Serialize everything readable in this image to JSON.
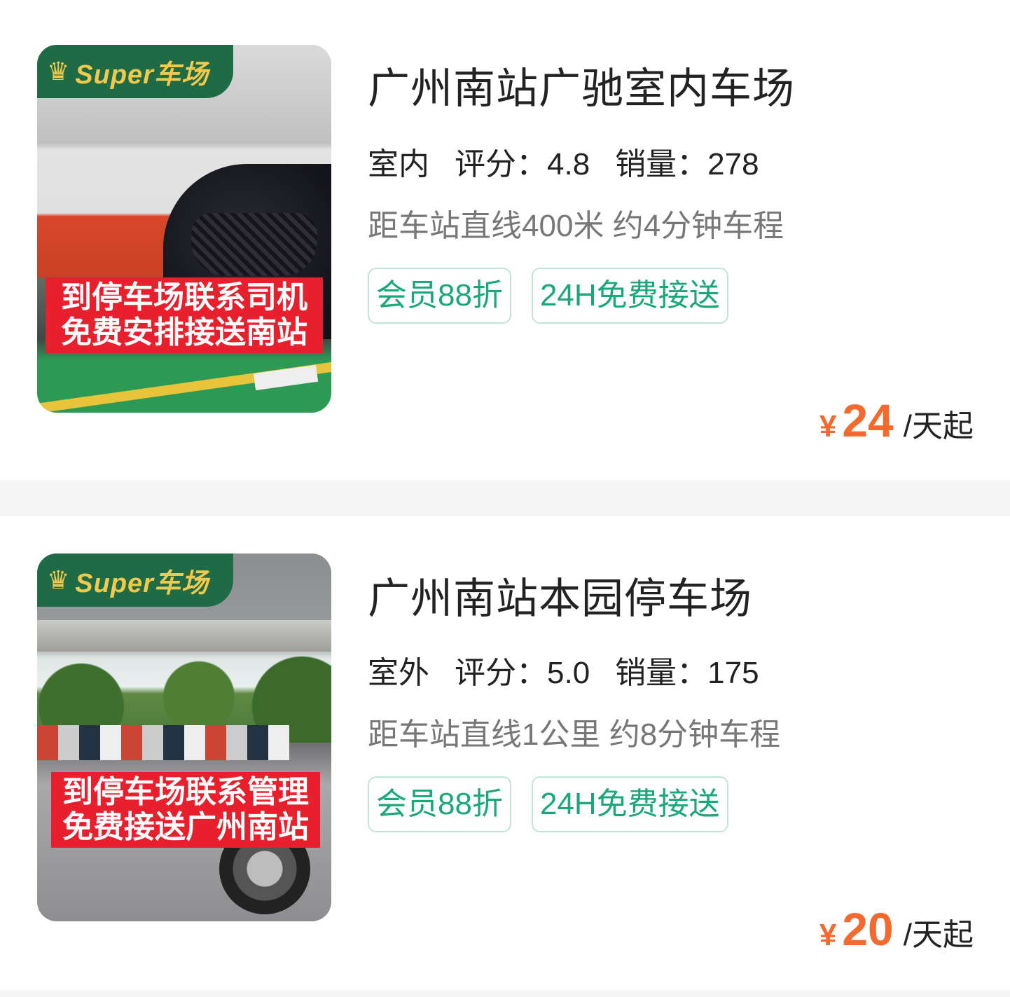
{
  "badge": {
    "icon": "crown-icon",
    "text": "Super车场"
  },
  "currency_symbol": "¥",
  "colors": {
    "brand_green": "#1e6b45",
    "tag_green": "#1aa878",
    "price_orange": "#f26a2e",
    "banner_red": "#e8202d"
  },
  "lots": [
    {
      "title": "广州南站广驰室内车场",
      "banner_lines": [
        "到停车场联系司机",
        "免费安排接送南站"
      ],
      "type": "室内",
      "rating": "评分：4.8",
      "sales": "销量：278",
      "distance": "距车站直线400米 约4分钟车程",
      "tags": [
        "会员88折",
        "24H免费接送"
      ],
      "price": "24",
      "unit": "/天起"
    },
    {
      "title": "广州南站本园停车场",
      "banner_lines": [
        "到停车场联系管理",
        "免费接送广州南站"
      ],
      "type": "室外",
      "rating": "评分：5.0",
      "sales": "销量：175",
      "distance": "距车站直线1公里 约8分钟车程",
      "tags": [
        "会员88折",
        "24H免费接送"
      ],
      "price": "20",
      "unit": "/天起"
    }
  ]
}
